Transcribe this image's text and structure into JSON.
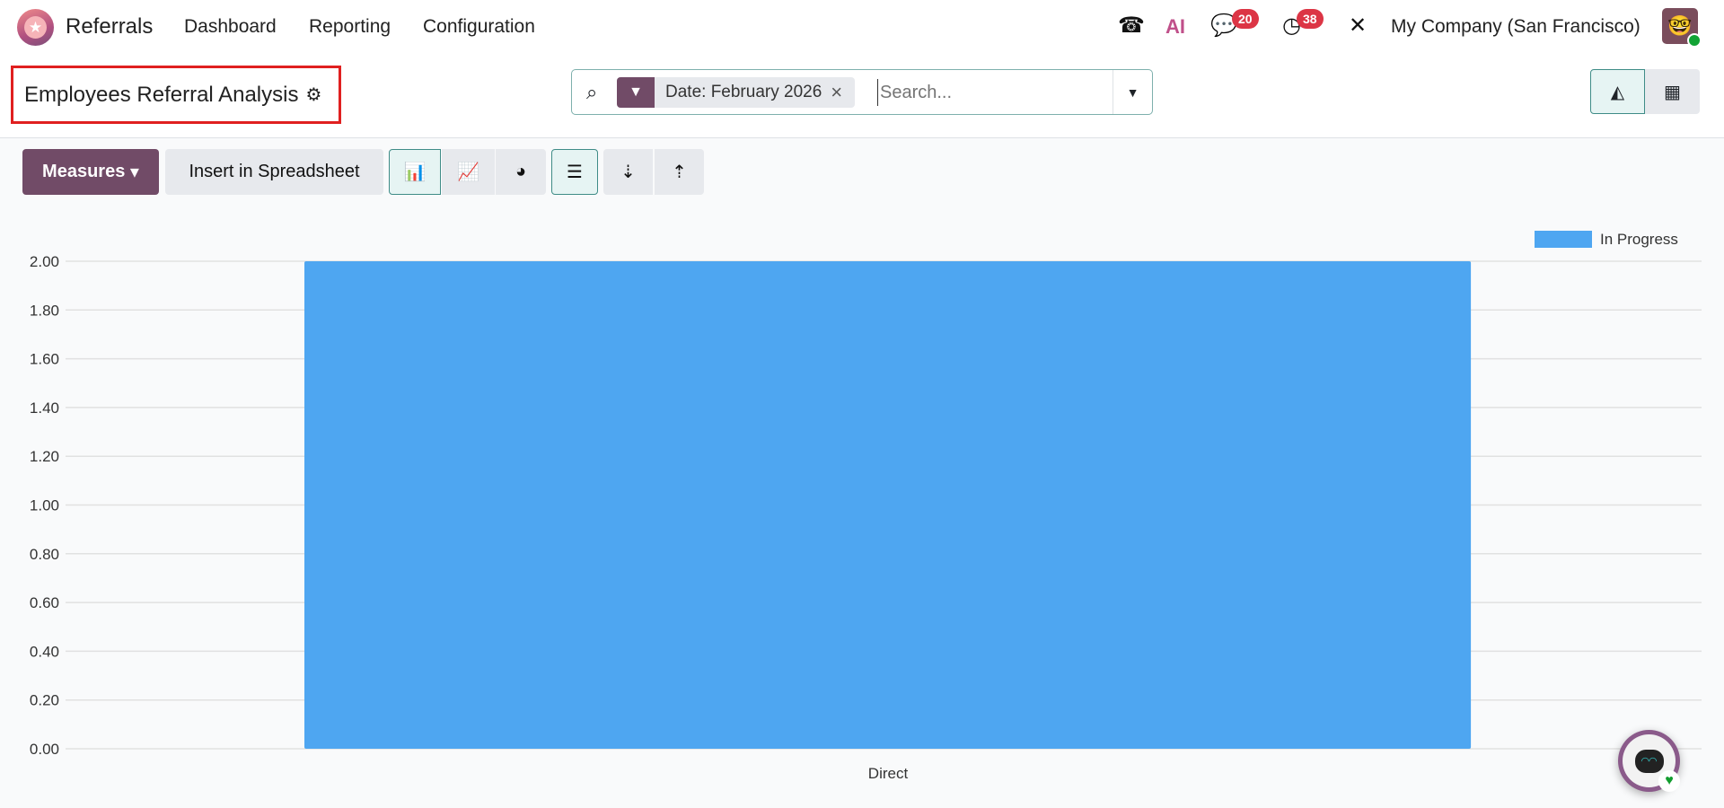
{
  "navbar": {
    "app_name": "Referrals",
    "menu": [
      "Dashboard",
      "Reporting",
      "Configuration"
    ],
    "ai_label": "AI",
    "messages_count": "20",
    "activities_count": "38",
    "company": "My Company (San Francisco)"
  },
  "control_panel": {
    "title": "Employees Referral Analysis",
    "facet": "Date: February 2026",
    "search_placeholder": "Search..."
  },
  "toolbar": {
    "measures_label": "Measures",
    "insert_label": "Insert in Spreadsheet"
  },
  "colors": {
    "bar": "#4ea6f1",
    "brand": "#714b67"
  },
  "chart_data": {
    "type": "bar",
    "categories": [
      "Direct"
    ],
    "series": [
      {
        "name": "In Progress",
        "values": [
          2
        ]
      }
    ],
    "ylim": [
      0,
      2
    ],
    "yticks": [
      "0.00",
      "0.20",
      "0.40",
      "0.60",
      "0.80",
      "1.00",
      "1.20",
      "1.40",
      "1.60",
      "1.80",
      "2.00"
    ],
    "legend": "top-right",
    "grid": true
  }
}
